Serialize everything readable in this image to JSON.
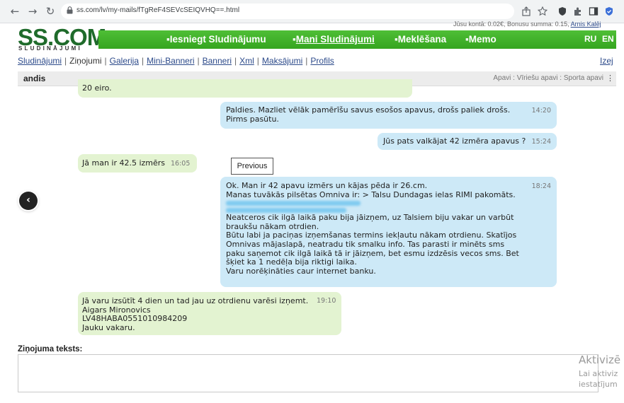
{
  "browser": {
    "url": "ss.com/lv/my-mails/fTgReF4SEVcSEIQVHQ==.html"
  },
  "header": {
    "balance_prefix": "Jūsu kontā: 0.02€, Bonusu summa: 0.15,",
    "user_link": "Arnis Kalēj",
    "logo_main": "SS.COM",
    "logo_sub": "SLUDINĀJUMI",
    "nav": [
      "Iesniegt Sludinājumu",
      "Mani Sludinājumi",
      "Meklēšana",
      "Memo"
    ],
    "lang_ru": "RU",
    "lang_en": "EN",
    "green": "#3cb22a"
  },
  "subnav": {
    "items": [
      "Sludinājumi",
      "Ziņojumi",
      "Galerija",
      "Mini-Banneri",
      "Banneri",
      "Xml",
      "Maksājumi",
      "Profils"
    ],
    "active": "Ziņojumi",
    "exit": "Izej"
  },
  "chat": {
    "name": "andis",
    "tags": "Apavi : Vīriešu apavi : Sporta apavi",
    "messages": [
      {
        "dir": "in",
        "text": "20 eiro.",
        "time": ""
      },
      {
        "dir": "out",
        "text": "Paldies. Mazliet vēlāk pamērīšu savus esošos apavus, drošs paliek drošs.\nPirms pasūtu.",
        "time": "14:20"
      },
      {
        "dir": "out",
        "text": "Jūs pats valkājat 42 izmēra apavus ?",
        "time": "15:24"
      },
      {
        "dir": "in",
        "text": "Jā man ir 42.5 izmērs",
        "time": "16:05"
      },
      {
        "dir": "out",
        "text": "Ok. Man ir 42 apavu izmērs un kājas pēda ir 26.cm.\nManas tuvākās pilsētas Omniva ir: > Talsu Dundagas ielas RIMI pakomāts.",
        "text2": "Neatceros cik ilgā laikā paku bija jāizņem, uz Talsiem biju vakar un varbūt\nbraukšu nākam otrdien.\nBūtu labi ja paciņas izņemšanas termins iekļautu nākam otrdienu. Skatījos\nOmnivas mājaslapā, neatradu tik smalku info. Tas parasti ir minēts sms\npaku saņemot cik ilgā laikā tā ir jāizņem, bet esmu izdzēsis vecos sms. Bet\nšķiet ka 1 nedēļa bija riktigi laika.\nVaru norēķināties caur internet banku.",
        "time": "18:24"
      },
      {
        "dir": "in",
        "text": "Jā varu izsūtīt 4 dien un tad jau uz otrdienu varēsi izņemt.\nAigars Mironovics\nLV48HABA0551010984209\nJauku vakaru.",
        "time": "19:10"
      }
    ]
  },
  "tooltip": "Previous",
  "compose": {
    "label": "Ziņojuma teksts:",
    "value": ""
  },
  "watermark": {
    "line1": "Aktivizē",
    "line2": "Lai aktiviz",
    "line3": "iestatījum"
  },
  "colors": {
    "incoming_bubble": "#e3f3d1",
    "outgoing_bubble": "#cde9f7",
    "link": "#2c4a8a"
  }
}
